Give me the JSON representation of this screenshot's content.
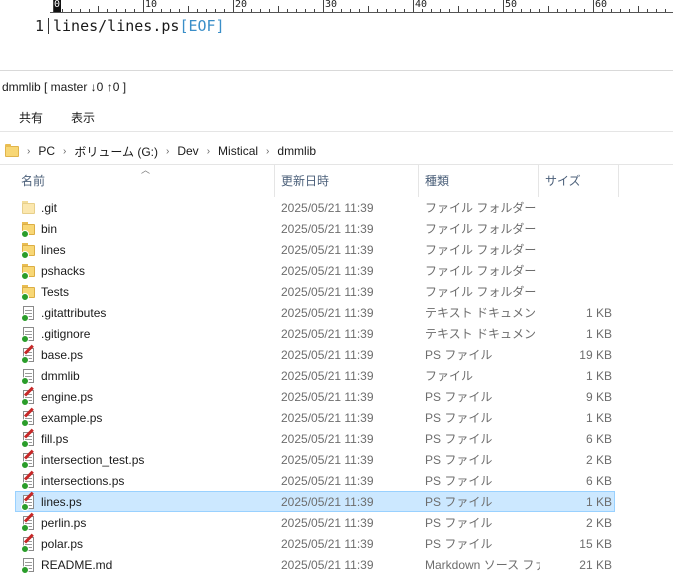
{
  "editor": {
    "ruler": {
      "cursor_label": "0",
      "labels": [
        "10",
        "20",
        "30",
        "40",
        "50",
        "60"
      ]
    },
    "line_number": "1",
    "line_text": "lines/lines.ps",
    "eof_marker": "[EOF]"
  },
  "explorer": {
    "title": "dmmlib [ master ↓0 ↑0 ]",
    "ribbon_tabs": [
      "共有",
      "表示"
    ],
    "breadcrumb": [
      "PC",
      "ボリューム (G:)",
      "Dev",
      "Mistical",
      "dmmlib"
    ],
    "columns": {
      "name": "名前",
      "date": "更新日時",
      "type": "種類",
      "size": "サイズ"
    },
    "files": [
      {
        "name": ".git",
        "date": "2025/05/21 11:39",
        "type": "ファイル フォルダー",
        "size": "",
        "icon": "folder-plain-icon"
      },
      {
        "name": "bin",
        "date": "2025/05/21 11:39",
        "type": "ファイル フォルダー",
        "size": "",
        "icon": "folder-git-icon"
      },
      {
        "name": "lines",
        "date": "2025/05/21 11:39",
        "type": "ファイル フォルダー",
        "size": "",
        "icon": "folder-git-icon"
      },
      {
        "name": "pshacks",
        "date": "2025/05/21 11:39",
        "type": "ファイル フォルダー",
        "size": "",
        "icon": "folder-git-icon"
      },
      {
        "name": "Tests",
        "date": "2025/05/21 11:39",
        "type": "ファイル フォルダー",
        "size": "",
        "icon": "folder-git-icon"
      },
      {
        "name": ".gitattributes",
        "date": "2025/05/21 11:39",
        "type": "テキスト ドキュメント",
        "size": "1 KB",
        "icon": "text-file-git-icon"
      },
      {
        "name": ".gitignore",
        "date": "2025/05/21 11:39",
        "type": "テキスト ドキュメント",
        "size": "1 KB",
        "icon": "text-file-git-icon"
      },
      {
        "name": "base.ps",
        "date": "2025/05/21 11:39",
        "type": "PS ファイル",
        "size": "19 KB",
        "icon": "ps-file-git-icon"
      },
      {
        "name": "dmmlib",
        "date": "2025/05/21 11:39",
        "type": "ファイル",
        "size": "1 KB",
        "icon": "text-file-git-icon"
      },
      {
        "name": "engine.ps",
        "date": "2025/05/21 11:39",
        "type": "PS ファイル",
        "size": "9 KB",
        "icon": "ps-file-git-icon"
      },
      {
        "name": "example.ps",
        "date": "2025/05/21 11:39",
        "type": "PS ファイル",
        "size": "1 KB",
        "icon": "ps-file-git-icon"
      },
      {
        "name": "fill.ps",
        "date": "2025/05/21 11:39",
        "type": "PS ファイル",
        "size": "6 KB",
        "icon": "ps-file-git-icon"
      },
      {
        "name": "intersection_test.ps",
        "date": "2025/05/21 11:39",
        "type": "PS ファイル",
        "size": "2 KB",
        "icon": "ps-file-git-icon"
      },
      {
        "name": "intersections.ps",
        "date": "2025/05/21 11:39",
        "type": "PS ファイル",
        "size": "6 KB",
        "icon": "ps-file-git-icon"
      },
      {
        "name": "lines.ps",
        "date": "2025/05/21 11:39",
        "type": "PS ファイル",
        "size": "1 KB",
        "icon": "ps-file-git-icon",
        "selected": true
      },
      {
        "name": "perlin.ps",
        "date": "2025/05/21 11:39",
        "type": "PS ファイル",
        "size": "2 KB",
        "icon": "ps-file-git-icon"
      },
      {
        "name": "polar.ps",
        "date": "2025/05/21 11:39",
        "type": "PS ファイル",
        "size": "15 KB",
        "icon": "ps-file-git-icon"
      },
      {
        "name": "README.md",
        "date": "2025/05/21 11:39",
        "type": "Markdown ソース ファイル",
        "size": "21 KB",
        "icon": "md-file-git-icon"
      }
    ]
  }
}
